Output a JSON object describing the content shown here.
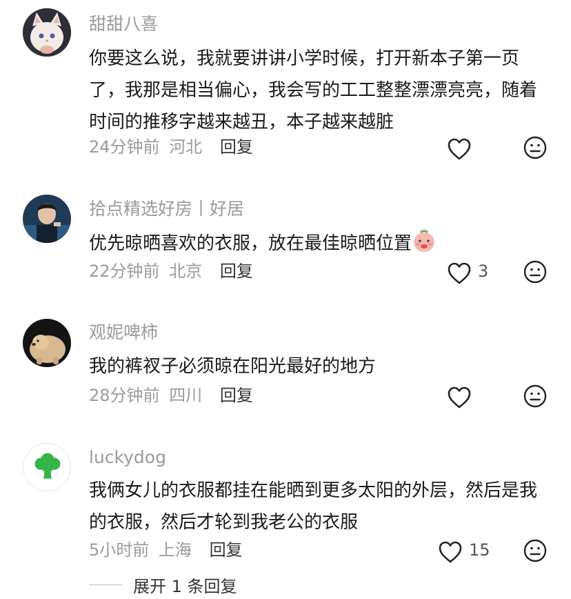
{
  "comments": [
    {
      "username": "甜甜八喜",
      "text": "你要这么说，我就要讲讲小学时候，打开新本子第一页了，我那是相当偏心，我会写的工工整整漂漂亮亮，随着时间的推移字越来越丑，本子越来越脏",
      "time": "24分钟前",
      "location": "河北",
      "reply_label": "回复",
      "likes": ""
    },
    {
      "username": "拾点精选好房丨好居",
      "text": "优先晾晒喜欢的衣服，放在最佳晾晒位置",
      "time": "22分钟前",
      "location": "北京",
      "reply_label": "回复",
      "likes": "3"
    },
    {
      "username": "观妮啤柿",
      "text": "我的裤衩子必须晾在阳光最好的地方",
      "time": "28分钟前",
      "location": "四川",
      "reply_label": "回复",
      "likes": ""
    },
    {
      "username": "luckydog",
      "text": "我俩女儿的衣服都挂在能晒到更多太阳的外层，然后是我的衣服，然后才轮到我老公的衣服",
      "time": "5小时前",
      "location": "上海",
      "reply_label": "回复",
      "likes": "15"
    }
  ],
  "expand_replies": "展开 1 条回复",
  "icons": {
    "like": "heart-outline-icon",
    "dislike": "neutral-face-icon",
    "emoji": "blushing-emoji-icon"
  },
  "colors": {
    "username": "#9a9a9a",
    "text": "#1a1a1a",
    "meta": "#9a9a9a",
    "icon": "#222222"
  }
}
